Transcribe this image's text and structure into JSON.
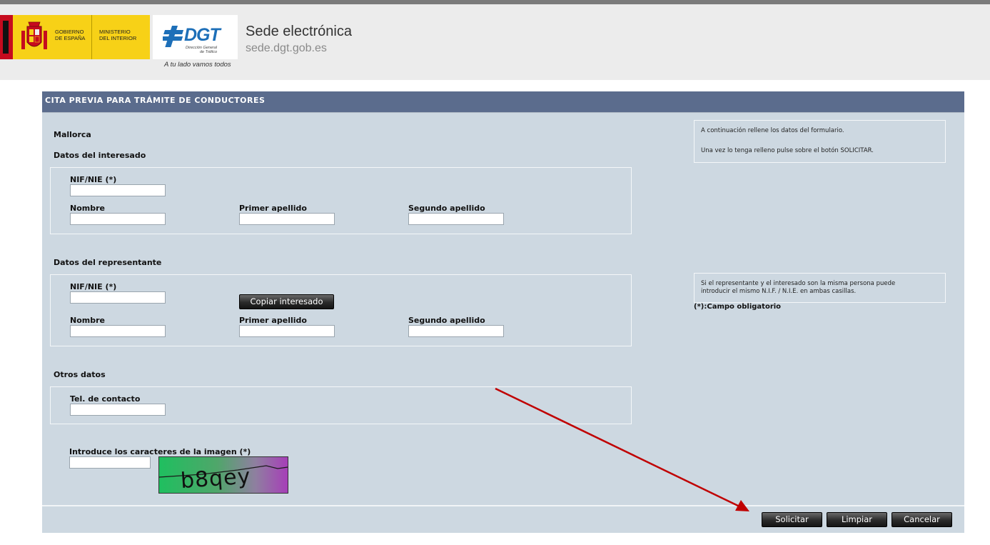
{
  "header": {
    "gov_line1": "GOBIERNO\nDE ESPAÑA",
    "gov_line2": "MINISTERIO\nDEL INTERIOR",
    "dgt_word": "DGT",
    "dgt_sub": "Dirección General\nde Tráfico",
    "dgt_slogan": "A tu lado vamos todos",
    "site_title": "Sede electrónica",
    "site_url": "sede.dgt.gob.es"
  },
  "panel": {
    "title": "CITA PREVIA PARA TRÁMITE DE CONDUCTORES",
    "office": "Mallorca"
  },
  "interesado": {
    "heading": "Datos del interesado",
    "nif_label": "NIF/NIE (*)",
    "nombre_label": "Nombre",
    "primer_label": "Primer apellido",
    "segundo_label": "Segundo apellido",
    "nif_value": "",
    "nombre_value": "",
    "primer_value": "",
    "segundo_value": ""
  },
  "representante": {
    "heading": "Datos del representante",
    "nif_label": "NIF/NIE (*)",
    "copy_button": "Copiar interesado",
    "nombre_label": "Nombre",
    "primer_label": "Primer apellido",
    "segundo_label": "Segundo apellido",
    "nif_value": "",
    "nombre_value": "",
    "primer_value": "",
    "segundo_value": ""
  },
  "otros": {
    "heading": "Otros datos",
    "tel_label": "Tel. de contacto",
    "tel_value": ""
  },
  "captcha": {
    "label": "Introduce los caracteres de la imagen (*)",
    "input_value": "",
    "image_text": "b8qey"
  },
  "info": {
    "line1": "A continuación rellene los datos del formulario.",
    "line2": "Una vez lo tenga relleno pulse sobre el botón SOLICITAR.",
    "rep_note": "Si el representante y el interesado son la misma persona puede\nintroducir el mismo N.I.F. / N.I.E. en ambas casillas.",
    "required_note": "(*):Campo obligatorio"
  },
  "buttons": {
    "solicitar": "Solicitar",
    "limpiar": "Limpiar",
    "cancelar": "Cancelar"
  },
  "colors": {
    "panel_header": "#5b6c8d",
    "panel_bg": "#cdd8e1",
    "annotation_arrow": "#c00000",
    "dgt_blue": "#1d6fb8",
    "gov_yellow": "#f7d117"
  }
}
